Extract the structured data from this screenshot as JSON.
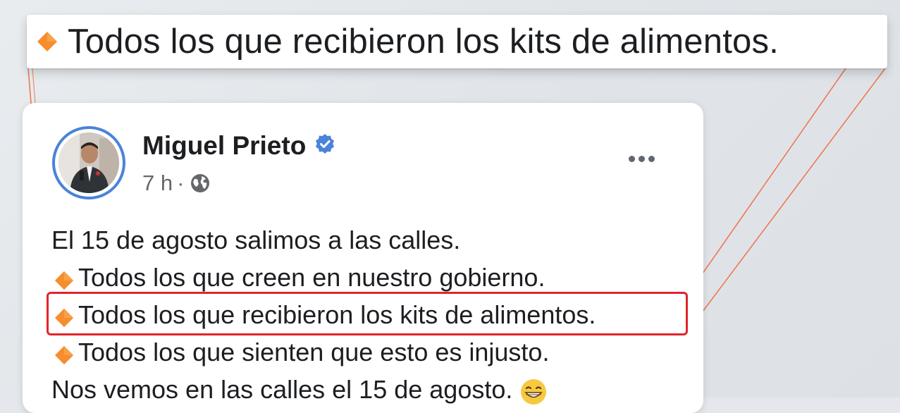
{
  "callout": {
    "text": "Todos los que recibieron los kits de alimentos.",
    "icon": "orange-diamond-icon"
  },
  "post": {
    "author": {
      "name": "Miguel Prieto",
      "verified_icon": "verified-badge-icon",
      "avatar": "profile-photo"
    },
    "meta": {
      "time": "7 h",
      "separator": "·",
      "audience_icon": "globe-icon"
    },
    "more_icon": "more-options-icon",
    "body": {
      "line1": "El 15 de agosto salimos a las calles.",
      "line2": "Todos los que creen en nuestro gobierno.",
      "line3": "Todos los que recibieron los kits de alimentos.",
      "line4": "Todos los que sienten que esto es injusto.",
      "line5": "Nos vemos en las calles el 15 de agosto.",
      "bullet_icon": "orange-diamond-icon",
      "trailing_emoji": "grinning-face-emoji"
    }
  },
  "colors": {
    "accent_diamond": "#f68d2e",
    "verified_blue": "#4a83d8",
    "highlight_red": "#e3242b",
    "connector_orange": "#f0663a"
  }
}
